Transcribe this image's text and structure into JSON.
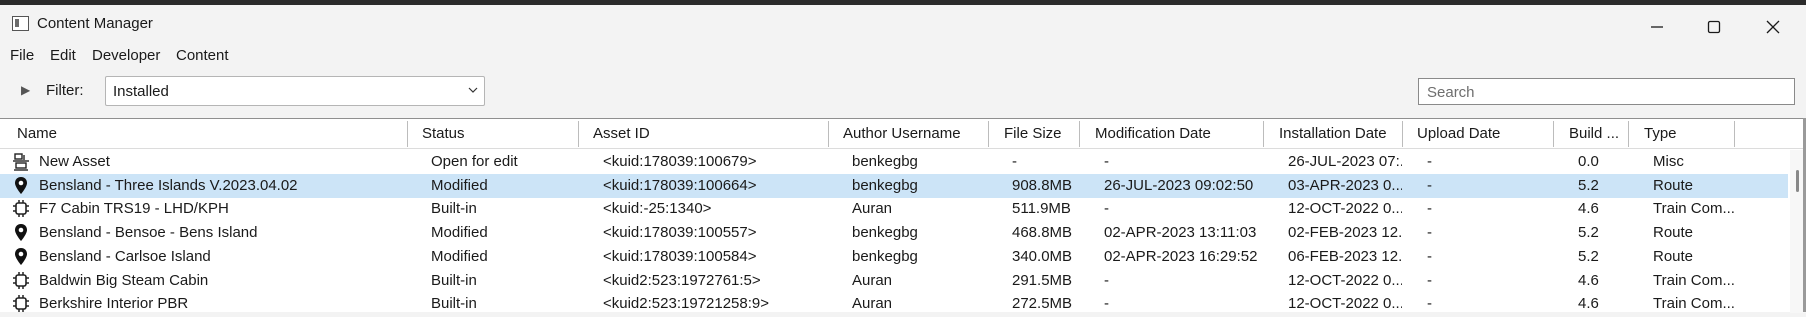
{
  "window": {
    "title": "Content Manager",
    "minimize_glyph": "—",
    "maximize_glyph": "☐",
    "close_glyph": "✕"
  },
  "menu": [
    "File",
    "Edit",
    "Developer",
    "Content"
  ],
  "filter": {
    "label": "Filter:",
    "value": "Installed",
    "search_placeholder": "Search"
  },
  "columns": [
    "Name",
    "Status",
    "Asset ID",
    "Author Username",
    "File Size",
    "Modification Date",
    "Installation Date",
    "Upload Date",
    "Build ...",
    "Type"
  ],
  "rows": [
    {
      "icon": "asset-icon",
      "name": "New Asset",
      "status": "Open for edit",
      "asset_id": "<kuid:178039:100679>",
      "author": "benkegbg",
      "size": "-",
      "mod_date": "-",
      "inst_date": "26-JUL-2023 07:...",
      "upload": "-",
      "build": "0.0",
      "type": "Misc",
      "selected": false
    },
    {
      "icon": "route-pin-icon",
      "name": "Bensland - Three Islands V.2023.04.02",
      "status": "Modified",
      "asset_id": "<kuid:178039:100664>",
      "author": "benkegbg",
      "size": "908.8MB",
      "mod_date": "26-JUL-2023 09:02:50",
      "inst_date": "03-APR-2023 0...",
      "upload": "-",
      "build": "5.2",
      "type": "Route",
      "selected": true
    },
    {
      "icon": "cabin-icon",
      "name": "F7 Cabin TRS19 - LHD/KPH",
      "status": "Built-in",
      "asset_id": "<kuid:-25:1340>",
      "author": "Auran",
      "size": "511.9MB",
      "mod_date": "-",
      "inst_date": "12-OCT-2022 0...",
      "upload": "-",
      "build": "4.6",
      "type": "Train Com...",
      "selected": false
    },
    {
      "icon": "route-pin-icon",
      "name": "Bensland - Bensoe - Bens Island",
      "status": "Modified",
      "asset_id": "<kuid:178039:100557>",
      "author": "benkegbg",
      "size": "468.8MB",
      "mod_date": "02-APR-2023 13:11:03",
      "inst_date": "02-FEB-2023 12...",
      "upload": "-",
      "build": "5.2",
      "type": "Route",
      "selected": false
    },
    {
      "icon": "route-pin-icon",
      "name": "Bensland - Carlsoe Island",
      "status": "Modified",
      "asset_id": "<kuid:178039:100584>",
      "author": "benkegbg",
      "size": "340.0MB",
      "mod_date": "02-APR-2023 16:29:52",
      "inst_date": "06-FEB-2023 12...",
      "upload": "-",
      "build": "5.2",
      "type": "Route",
      "selected": false
    },
    {
      "icon": "cabin-icon",
      "name": "Baldwin Big Steam Cabin",
      "status": "Built-in",
      "asset_id": "<kuid2:523:1972761:5>",
      "author": "Auran",
      "size": "291.5MB",
      "mod_date": "-",
      "inst_date": "12-OCT-2022 0...",
      "upload": "-",
      "build": "4.6",
      "type": "Train Com...",
      "selected": false
    },
    {
      "icon": "cabin-icon",
      "name": "Berkshire Interior PBR",
      "status": "Built-in",
      "asset_id": "<kuid2:523:19721258:9>",
      "author": "Auran",
      "size": "272.5MB",
      "mod_date": "-",
      "inst_date": "12-OCT-2022 0...",
      "upload": "-",
      "build": "4.6",
      "type": "Train Com...",
      "selected": false
    }
  ]
}
